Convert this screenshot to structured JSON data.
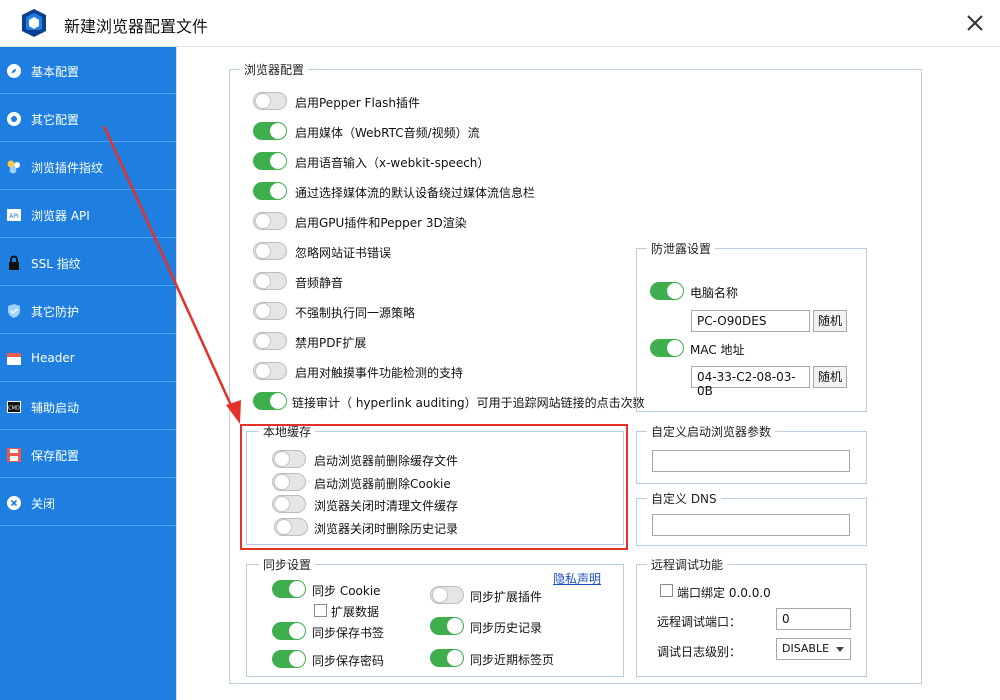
{
  "window": {
    "title": "新建浏览器配置文件",
    "close_icon": "close-icon"
  },
  "colors": {
    "sidebar": "#1e7fe0",
    "toggle_on": "#3fae4c",
    "highlight": "#e5302a",
    "link": "#1a4fc4"
  },
  "sidebar": {
    "items": [
      {
        "label": "基本配置",
        "icon": "compass-icon"
      },
      {
        "label": "其它配置",
        "icon": "chrome-icon"
      },
      {
        "label": "浏览插件指纹",
        "icon": "puzzle-icon"
      },
      {
        "label": "浏览器 API",
        "icon": "api-icon"
      },
      {
        "label": "SSL 指纹",
        "icon": "lock-icon"
      },
      {
        "label": "其它防护",
        "icon": "shield-icon"
      },
      {
        "label": "Header",
        "icon": "header-icon"
      },
      {
        "label": "辅助启动",
        "icon": "cmd-icon"
      },
      {
        "label": "保存配置",
        "icon": "save-icon"
      },
      {
        "label": "关闭",
        "icon": "close-circle-icon"
      }
    ]
  },
  "browser_config": {
    "title": "浏览器配置",
    "options": [
      {
        "label": "启用Pepper Flash插件",
        "on": false
      },
      {
        "label": "启用媒体（WebRTC音频/视频）流",
        "on": true
      },
      {
        "label": "启用语音输入（x-webkit-speech）",
        "on": true
      },
      {
        "label": "通过选择媒体流的默认设备绕过媒体流信息栏",
        "on": true
      },
      {
        "label": "启用GPU插件和Pepper 3D渲染",
        "on": false
      },
      {
        "label": "忽略网站证书错误",
        "on": false
      },
      {
        "label": "音频静音",
        "on": false
      },
      {
        "label": "不强制执行同一源策略",
        "on": false
      },
      {
        "label": "禁用PDF扩展",
        "on": false
      },
      {
        "label": "启用对触摸事件功能检测的支持",
        "on": false
      },
      {
        "label": "链接审计（ hyperlink auditing）可用于追踪网站链接的点击次数",
        "on": true
      }
    ]
  },
  "local_cache": {
    "title": "本地缓存",
    "options": [
      {
        "label": "启动浏览器前删除缓存文件",
        "on": false
      },
      {
        "label": "启动浏览器前删除Cookie",
        "on": false
      },
      {
        "label": "浏览器关闭时清理文件缓存",
        "on": false
      },
      {
        "label": "浏览器关闭时删除历史记录",
        "on": false
      }
    ]
  },
  "sync": {
    "title": "同步设置",
    "privacy_link": "隐私声明",
    "cookie": {
      "label": "同步 Cookie",
      "on": true
    },
    "ext_data": {
      "label": "扩展数据",
      "checked": false
    },
    "bookmarks": {
      "label": "同步保存书签",
      "on": true
    },
    "passwords": {
      "label": "同步保存密码",
      "on": true
    },
    "extensions": {
      "label": "同步扩展插件",
      "on": false
    },
    "history": {
      "label": "同步历史记录",
      "on": true
    },
    "recent_tabs": {
      "label": "同步近期标签页",
      "on": true
    }
  },
  "leak_protect": {
    "title": "防泄露设置",
    "computer_name": {
      "label": "电脑名称",
      "on": true,
      "value": "PC-O90DES",
      "button": "随机"
    },
    "mac_address": {
      "label": "MAC 地址",
      "on": true,
      "value": "04-33-C2-08-03-0B",
      "button": "随机"
    }
  },
  "custom_params": {
    "title": "自定义启动浏览器参数",
    "value": ""
  },
  "custom_dns": {
    "title": "自定义 DNS",
    "value": ""
  },
  "remote_debug": {
    "title": "远程调试功能",
    "bind": {
      "label": "端口绑定 0.0.0.0",
      "checked": false
    },
    "port": {
      "label": "远程调试端口：",
      "value": "0"
    },
    "log_level": {
      "label": "调试日志级别：",
      "value": "DISABLE"
    }
  }
}
